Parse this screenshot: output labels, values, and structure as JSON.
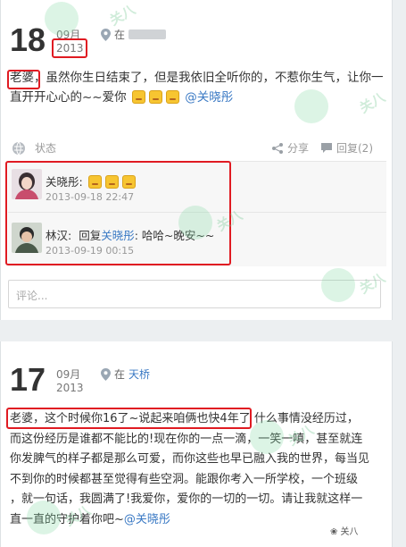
{
  "post1": {
    "day": "18",
    "month": "09月",
    "year": "2013",
    "location_prefix": "在",
    "text_lines": [
      "老婆，虽然你生日结束了，但是我依旧全听你的，不惹你生气，让你一",
      "直开开心心的~~爱你"
    ],
    "mention": "@关晓彤",
    "actions": {
      "status_label": "状态",
      "share_label": "分享",
      "reply_label": "回复(2)"
    },
    "comments": [
      {
        "name": "关晓彤:",
        "time": "2013-09-18 22:47"
      },
      {
        "name": "林汉:",
        "text": "回复",
        "reply_to": "关晓彤",
        "reply_text": ": 哈哈~晚安~~",
        "time": "2013-09-19 00:15"
      }
    ],
    "comment_placeholder": "评论..."
  },
  "post2": {
    "day": "17",
    "month": "09月",
    "year": "2013",
    "location_prefix": "在",
    "location_name": "天桥",
    "text_lines": [
      "老婆，这个时候你16了~说起来咱俩也快4年了  什么事情没经历过，",
      "而这份经历是谁都不能比的!现在你的一点一滴，一笑一嗔，甚至就连",
      "你发脾气的样子都是那么可爱，而你这些也早已融入我的世界，每当见",
      "不到你的时候都甚至觉得有些空洞。能跟你考入一所学校，一个班级",
      "，就一句话，我圆满了!我爱你，爱你的一切的一切。请让我就这样一",
      "直一直的守护着你吧~"
    ],
    "mention": "@关晓彤"
  },
  "watermark_text": "关八",
  "footer_text": "❀ 关八",
  "colors": {
    "accent": "#3a79c4",
    "highlight_box": "#e01b22",
    "watermark": "#82d7a0"
  }
}
